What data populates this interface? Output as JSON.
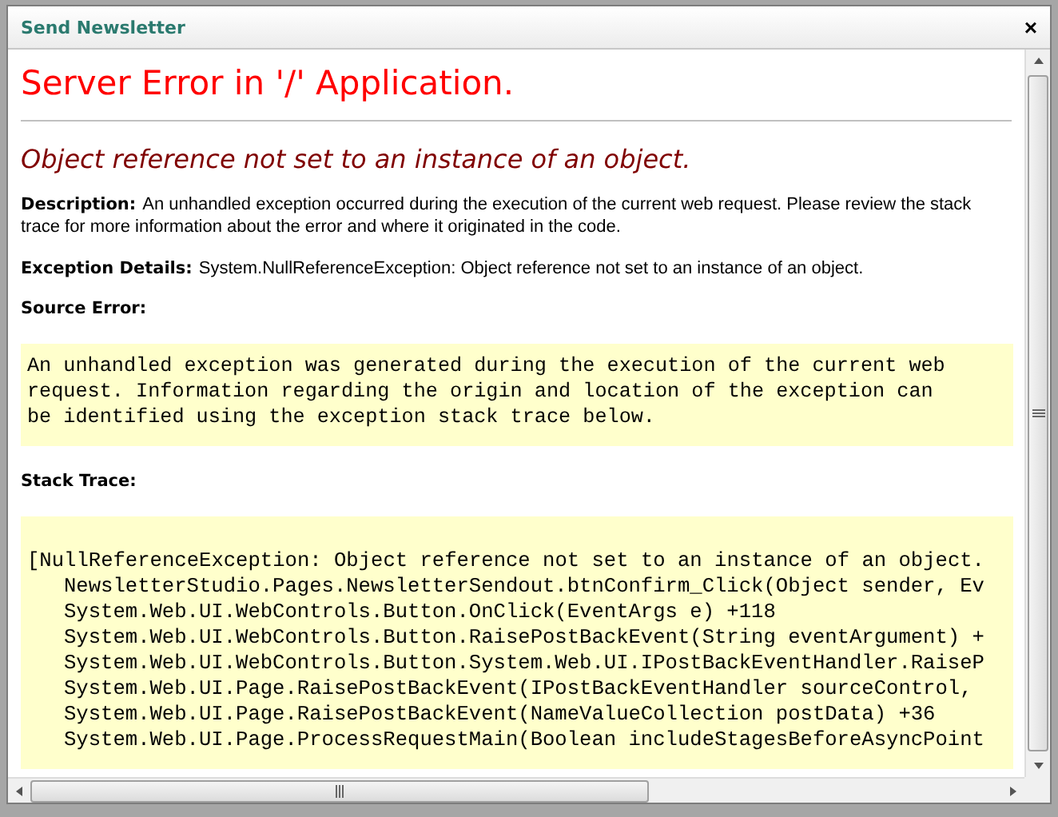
{
  "dialog": {
    "title": "Send Newsletter",
    "close": "×"
  },
  "page": {
    "title": "Server Error in '/' Application.",
    "subtitle": "Object reference not set to an instance of an object.",
    "description_label": "Description:",
    "description": "An unhandled exception occurred during the execution of the current web request. Please review the stack trace for more information about the error and where it originated in the code.",
    "details_label": "Exception Details:",
    "details": "System.NullReferenceException: Object reference not set to an instance of an object.",
    "source_label": "Source Error:",
    "source_lines": [
      "An unhandled exception was generated during the execution of the current web",
      "request. Information regarding the origin and location of the exception can",
      "be identified using the exception stack trace below."
    ],
    "stack_label": "Stack Trace:",
    "stack_lines": [
      {
        "text": "[NullReferenceException: Object reference not set to an instance of an object.",
        "indented": false
      },
      {
        "text": "NewsletterStudio.Pages.NewsletterSendout.btnConfirm_Click(Object sender, Ev",
        "indented": true
      },
      {
        "text": "System.Web.UI.WebControls.Button.OnClick(EventArgs e) +118",
        "indented": true
      },
      {
        "text": "System.Web.UI.WebControls.Button.RaisePostBackEvent(String eventArgument) +",
        "indented": true
      },
      {
        "text": "System.Web.UI.WebControls.Button.System.Web.UI.IPostBackEventHandler.RaiseP",
        "indented": true
      },
      {
        "text": "System.Web.UI.Page.RaisePostBackEvent(IPostBackEventHandler sourceControl,",
        "indented": true
      },
      {
        "text": "System.Web.UI.Page.RaisePostBackEvent(NameValueCollection postData) +36",
        "indented": true
      },
      {
        "text": "System.Web.UI.Page.ProcessRequestMain(Boolean includeStagesBeforeAsyncPoint",
        "indented": true
      }
    ]
  }
}
